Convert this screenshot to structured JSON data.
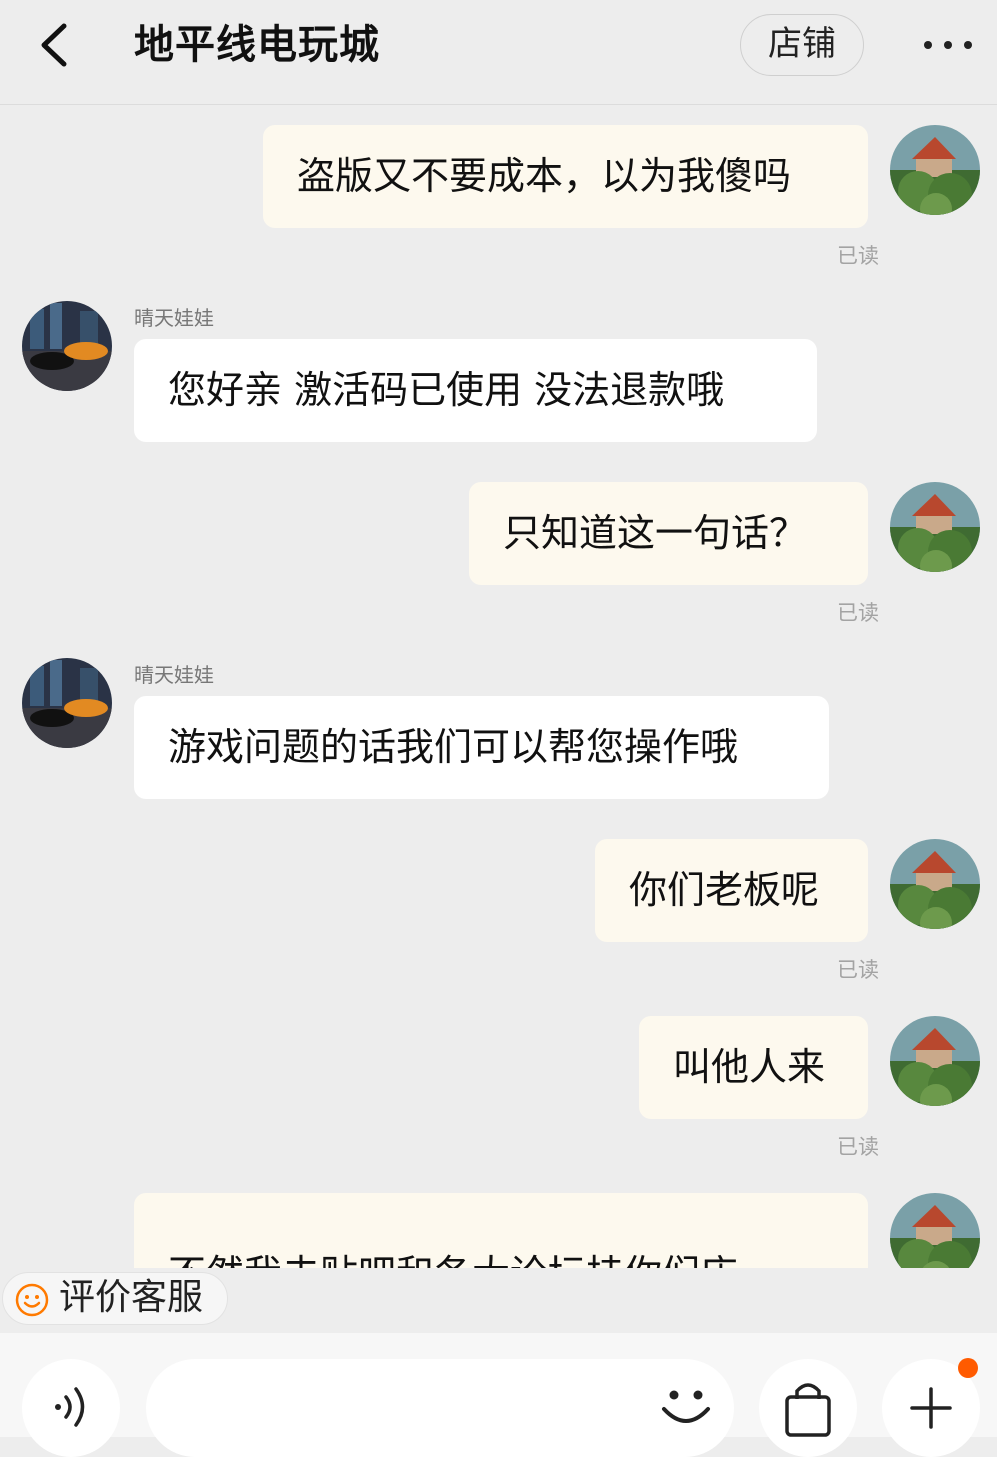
{
  "header": {
    "title": "地平线电玩城",
    "shop_button": "店铺"
  },
  "messages": [
    {
      "from": "me",
      "text": "盗版又不要成本，以为我傻吗",
      "status": "已读"
    },
    {
      "from": "them",
      "sender": "晴天娃娃",
      "text": "您好亲  激活码已使用 没法退款哦"
    },
    {
      "from": "me",
      "text": "只知道这一句话？",
      "status": "已读"
    },
    {
      "from": "them",
      "sender": "晴天娃娃",
      "text": "游戏问题的话我们可以帮您操作哦"
    },
    {
      "from": "me",
      "text": "你们老板呢",
      "status": "已读"
    },
    {
      "from": "me",
      "text": "叫他人来",
      "status": "已读"
    },
    {
      "from": "me",
      "text": "不然我去贴吧和各大论坛挂你们店，"
    }
  ],
  "rate_service": {
    "label": "评价客服"
  },
  "input_bar": {
    "message_value": ""
  },
  "colors": {
    "background": "#ededed",
    "my_bubble": "#fdf9ee",
    "their_bubble": "#ffffff",
    "accent": "#ff5b00",
    "smile_icon": "#ff7a00"
  },
  "icons": [
    "back-arrow-icon",
    "more-dots-icon",
    "smile-icon",
    "voice-icon",
    "emoji-icon",
    "shopping-bag-icon",
    "plus-icon"
  ]
}
